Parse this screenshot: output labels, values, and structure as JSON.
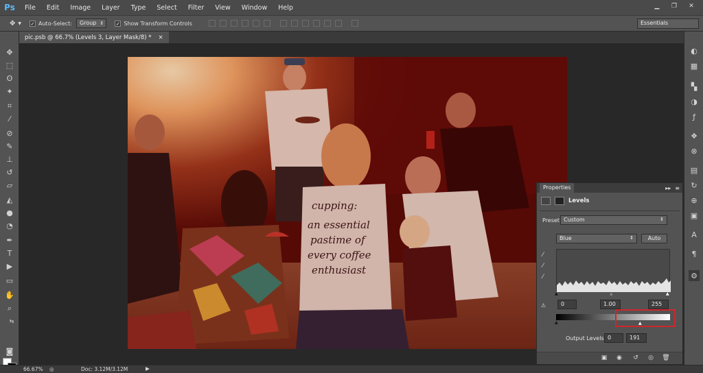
{
  "app": {
    "logo": "Ps"
  },
  "menu": [
    "File",
    "Edit",
    "Image",
    "Layer",
    "Type",
    "Select",
    "Filter",
    "View",
    "Window",
    "Help"
  ],
  "window_controls": [
    "minimize-icon",
    "restore-icon",
    "close-icon"
  ],
  "options": {
    "auto_select_label": "Auto-Select:",
    "auto_select_value": "Group",
    "show_transform_label": "Show Transform Controls",
    "workspace": "Essentials"
  },
  "document": {
    "tab_title": "pic.psb @ 66.7% (Levels 3, Layer Mask/8) *",
    "close": "×"
  },
  "properties": {
    "panel_tab": "Properties",
    "adjustment_title": "Levels",
    "preset_label": "Preset:",
    "preset_value": "Custom",
    "channel_value": "Blue",
    "auto_button": "Auto",
    "input_black": "0",
    "input_gamma": "1.00",
    "input_white": "255",
    "output_label": "Output Levels:",
    "output_black": "0",
    "output_white": "191"
  },
  "status": {
    "zoom": "66.67%",
    "doc_info": "Doc: 3.12M/3.12M"
  },
  "photo_text": [
    "cupping:",
    "an essential",
    "pastime of",
    "every coffee",
    "enthusiast"
  ],
  "colors": {
    "menubar": "#4a4a4a",
    "panel": "#535353",
    "highlight": "#d0262a",
    "ps_blue": "#5fb8f6"
  }
}
